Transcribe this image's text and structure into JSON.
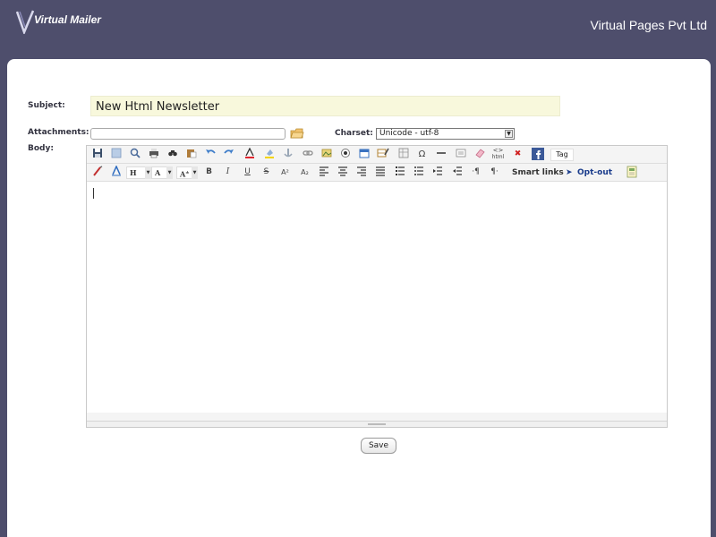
{
  "header": {
    "logo_text": "Virtual Mailer",
    "company": "Virtual Pages Pvt Ltd"
  },
  "form": {
    "subject_label": "Subject:",
    "subject_value": "New Html Newsletter",
    "attachments_label": "Attachments:",
    "charset_label": "Charset:",
    "charset_value": "Unicode - utf-8",
    "body_label": "Body:",
    "save_label": "Save"
  },
  "toolbar": {
    "heading_label": "H",
    "font_label": "A",
    "size_label": "A",
    "size_sup": "±",
    "bold": "B",
    "italic": "I",
    "underline": "U",
    "strike": "S",
    "superscript": "A²",
    "subscript": "A₂",
    "omega": "Ω",
    "tag_label": "Tag",
    "smart_links_label": "Smart links",
    "opt_out_label": "Opt-out",
    "html_label": "html"
  },
  "colors": {
    "background": "#4e4e6c",
    "subject_bg": "#f8f8dc",
    "opt_out": "#1a3c8c",
    "facebook": "#3b5998"
  }
}
